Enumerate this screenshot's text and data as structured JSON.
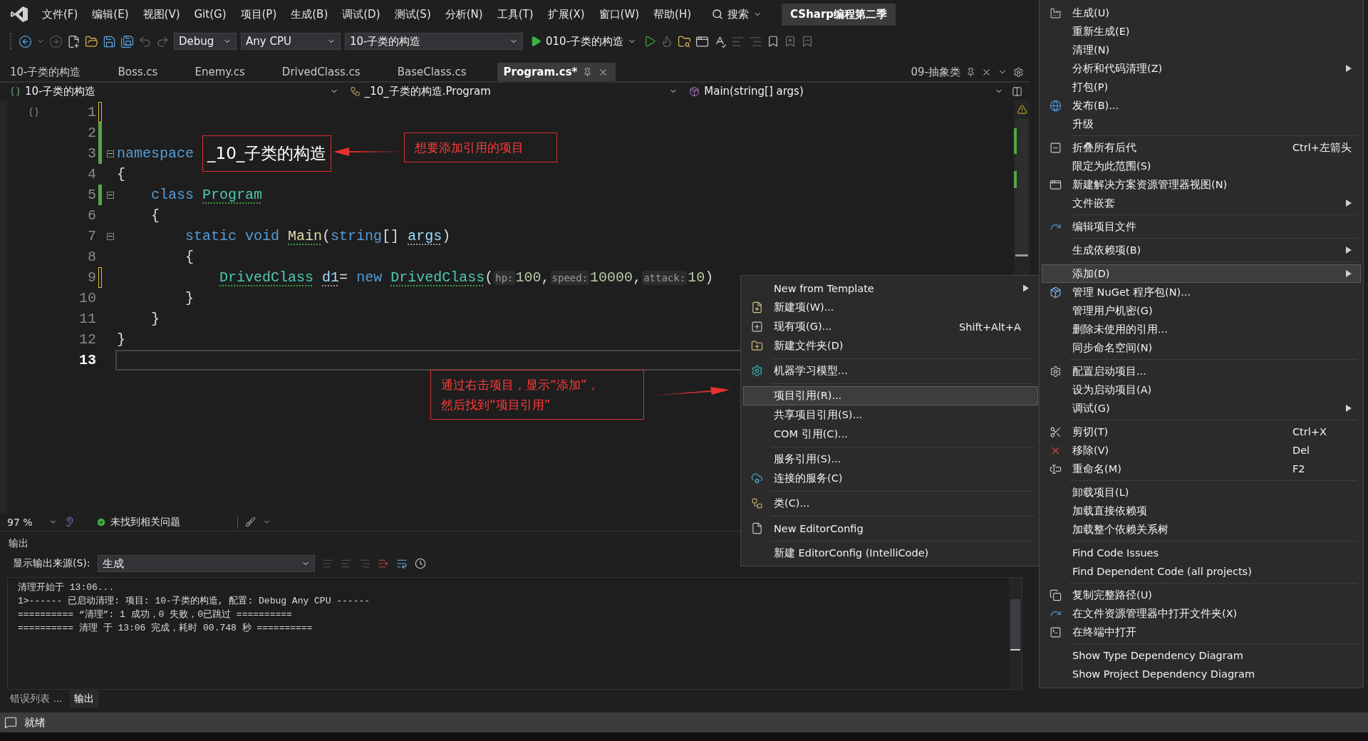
{
  "menu_bar": {
    "items": [
      "文件(F)",
      "编辑(E)",
      "视图(V)",
      "Git(G)",
      "项目(P)",
      "生成(B)",
      "调试(D)",
      "测试(S)",
      "分析(N)",
      "工具(T)",
      "扩展(X)",
      "窗口(W)",
      "帮助(H)"
    ],
    "search": "搜索",
    "solution_title": "CSharp编程第二季"
  },
  "toolbar": {
    "configuration": "Debug",
    "platform": "Any CPU",
    "startup_project": "10-子类的构造",
    "run_target": "010-子类的构造"
  },
  "tabs": [
    {
      "label": "10-子类的构造",
      "selected": false
    },
    {
      "label": "Boss.cs",
      "selected": false
    },
    {
      "label": "Enemy.cs",
      "selected": false
    },
    {
      "label": "DrivedClass.cs",
      "selected": false
    },
    {
      "label": "BaseClass.cs",
      "selected": false
    },
    {
      "label": "Program.cs*",
      "selected": true
    }
  ],
  "preview_tab": {
    "label": "09-抽象类"
  },
  "nav_bar": {
    "project": "10-子类的构造",
    "type": "_10_子类的构造.Program",
    "member": "Main(string[] args)"
  },
  "code": {
    "lines": [
      {
        "number": "1",
        "changed": true,
        "saved": false,
        "fold": false,
        "current": false
      },
      {
        "number": "2",
        "changed": true,
        "saved": true,
        "fold": false,
        "current": false
      },
      {
        "number": "3",
        "changed": true,
        "saved": true,
        "fold": true,
        "current": false,
        "tokens": [
          {
            "kind": "keyword",
            "text": "namespace "
          },
          {
            "kind": "boxed",
            "text": "_10_子类的构造"
          }
        ]
      },
      {
        "number": "4",
        "changed": false,
        "fold": false,
        "current": false,
        "tokens": [
          {
            "kind": "plain",
            "text": "{"
          }
        ]
      },
      {
        "number": "5",
        "changed": true,
        "saved": true,
        "fold": true,
        "current": false,
        "tokens": [
          {
            "kind": "keyword",
            "text": "    class "
          },
          {
            "kind": "type",
            "text": "Program",
            "dotted": true
          }
        ]
      },
      {
        "number": "6",
        "changed": false,
        "fold": false,
        "current": false,
        "tokens": [
          {
            "kind": "plain",
            "text": "    {"
          }
        ]
      },
      {
        "number": "7",
        "changed": false,
        "fold": true,
        "current": false,
        "tokens": [
          {
            "kind": "keyword",
            "text": "        static void "
          },
          {
            "kind": "method",
            "text": "Main",
            "dotted": true
          },
          {
            "kind": "plain",
            "text": "("
          },
          {
            "kind": "keyword",
            "text": "string"
          },
          {
            "kind": "plain",
            "text": "[] "
          },
          {
            "kind": "param",
            "text": "args",
            "dotted": true
          },
          {
            "kind": "plain",
            "text": ")"
          }
        ]
      },
      {
        "number": "8",
        "changed": false,
        "fold": false,
        "current": false,
        "tokens": [
          {
            "kind": "plain",
            "text": "        {"
          }
        ]
      },
      {
        "number": "9",
        "changed": true,
        "saved": false,
        "fold": false,
        "current": false,
        "tokens": [
          {
            "kind": "type",
            "text": "            DrivedClass",
            "dotted": true
          },
          {
            "kind": "param",
            "text": " d1",
            "dotted": true
          },
          {
            "kind": "plain",
            "text": "= "
          },
          {
            "kind": "keyword",
            "text": "new "
          },
          {
            "kind": "type",
            "text": "DrivedClass",
            "dotted": true
          },
          {
            "kind": "plain",
            "text": "("
          },
          {
            "kind": "hint",
            "text": "hp:"
          },
          {
            "kind": "number",
            "text": "100"
          },
          {
            "kind": "plain",
            "text": ","
          },
          {
            "kind": "hint",
            "text": "speed:"
          },
          {
            "kind": "number",
            "text": "10000"
          },
          {
            "kind": "plain",
            "text": ","
          },
          {
            "kind": "hint",
            "text": "attack:"
          },
          {
            "kind": "number",
            "text": "10"
          },
          {
            "kind": "plain",
            "text": ")"
          }
        ]
      },
      {
        "number": "10",
        "changed": false,
        "fold": false,
        "current": false,
        "tokens": [
          {
            "kind": "plain",
            "text": "        }"
          }
        ]
      },
      {
        "number": "11",
        "changed": false,
        "fold": false,
        "current": false,
        "tokens": [
          {
            "kind": "plain",
            "text": "    }"
          }
        ]
      },
      {
        "number": "12",
        "changed": false,
        "fold": false,
        "current": false,
        "tokens": [
          {
            "kind": "plain",
            "text": "}"
          }
        ]
      },
      {
        "number": "13",
        "changed": false,
        "fold": false,
        "current": true
      }
    ]
  },
  "editor_status": {
    "zoom": "97 %",
    "issues": "未找到相关问题"
  },
  "output": {
    "title": "输出",
    "source_label": "显示输出来源(S):",
    "source": "生成",
    "lines": [
      "清理开始于 13:06...",
      "1>------ 已启动清理: 项目: 10-子类的构造, 配置: Debug Any CPU ------",
      "========== “清理”: 1 成功，0 失败，0已跳过 ==========",
      "========== 清理 于 13:06 完成，耗时 00.748 秒 =========="
    ]
  },
  "bottom_tabs": [
    {
      "label": "错误列表 ...",
      "selected": false
    },
    {
      "label": "输出",
      "selected": true
    }
  ],
  "status_bar": {
    "text": "就绪"
  },
  "annotations": [
    {
      "lines": [
        "想要添加引用的项目"
      ]
    },
    {
      "lines": [
        "通过右击项目，显示“添加”，",
        "然后找到“项目引用”"
      ]
    }
  ],
  "add_submenu": {
    "items": [
      {
        "kind": "item",
        "label": "New from Template",
        "submenu": true,
        "selected": false
      },
      {
        "kind": "item",
        "label": "新建项(W)...",
        "submenu": false,
        "selected": false
      },
      {
        "kind": "item",
        "label": "现有项(G)...",
        "shortcut": "Shift+Alt+A",
        "submenu": false,
        "selected": false
      },
      {
        "kind": "item",
        "label": "新建文件夹(D)",
        "submenu": false,
        "selected": false
      },
      {
        "kind": "separator"
      },
      {
        "kind": "item",
        "label": "机器学习模型...",
        "submenu": false,
        "selected": false
      },
      {
        "kind": "separator"
      },
      {
        "kind": "item",
        "label": "项目引用(R)...",
        "submenu": false,
        "selected": true
      },
      {
        "kind": "item",
        "label": "共享项目引用(S)...",
        "submenu": false,
        "selected": false
      },
      {
        "kind": "item",
        "label": "COM 引用(C)...",
        "submenu": false,
        "selected": false
      },
      {
        "kind": "separator"
      },
      {
        "kind": "item",
        "label": "服务引用(S)...",
        "submenu": false,
        "selected": false
      },
      {
        "kind": "item",
        "label": "连接的服务(C)",
        "submenu": false,
        "selected": false
      },
      {
        "kind": "separator"
      },
      {
        "kind": "item",
        "label": "类(C)...",
        "submenu": false,
        "selected": false
      },
      {
        "kind": "separator"
      },
      {
        "kind": "item",
        "label": "New EditorConfig",
        "submenu": false,
        "selected": false
      },
      {
        "kind": "separator"
      },
      {
        "kind": "item",
        "label": "新建 EditorConfig (IntelliCode)",
        "submenu": false,
        "selected": false
      }
    ]
  },
  "project_menu": {
    "items": [
      {
        "kind": "item",
        "label": "生成(U)",
        "submenu": false,
        "selected": false
      },
      {
        "kind": "item",
        "label": "重新生成(E)",
        "submenu": false,
        "selected": false
      },
      {
        "kind": "item",
        "label": "清理(N)",
        "submenu": false,
        "selected": false
      },
      {
        "kind": "item",
        "label": "分析和代码清理(Z)",
        "submenu": true,
        "selected": false
      },
      {
        "kind": "item",
        "label": "打包(P)",
        "submenu": false,
        "selected": false
      },
      {
        "kind": "item",
        "label": "发布(B)...",
        "submenu": false,
        "selected": false
      },
      {
        "kind": "item",
        "label": "升级",
        "submenu": false,
        "selected": false
      },
      {
        "kind": "separator"
      },
      {
        "kind": "item",
        "label": "折叠所有后代",
        "shortcut": "Ctrl+左箭头",
        "submenu": false,
        "selected": false
      },
      {
        "kind": "item",
        "label": "限定为此范围(S)",
        "submenu": false,
        "selected": false
      },
      {
        "kind": "item",
        "label": "新建解决方案资源管理器视图(N)",
        "submenu": false,
        "selected": false
      },
      {
        "kind": "item",
        "label": "文件嵌套",
        "submenu": true,
        "selected": false
      },
      {
        "kind": "separator"
      },
      {
        "kind": "item",
        "label": "编辑项目文件",
        "submenu": false,
        "selected": false
      },
      {
        "kind": "separator"
      },
      {
        "kind": "item",
        "label": "生成依赖项(B)",
        "submenu": true,
        "selected": false
      },
      {
        "kind": "separator"
      },
      {
        "kind": "item",
        "label": "添加(D)",
        "submenu": true,
        "selected": true
      },
      {
        "kind": "item",
        "label": "管理 NuGet 程序包(N)...",
        "submenu": false,
        "selected": false
      },
      {
        "kind": "item",
        "label": "管理用户机密(G)",
        "submenu": false,
        "selected": false
      },
      {
        "kind": "item",
        "label": "删除未使用的引用...",
        "submenu": false,
        "selected": false
      },
      {
        "kind": "item",
        "label": "同步命名空间(N)",
        "submenu": false,
        "selected": false
      },
      {
        "kind": "separator"
      },
      {
        "kind": "item",
        "label": "配置启动项目...",
        "submenu": false,
        "selected": false
      },
      {
        "kind": "item",
        "label": "设为启动项目(A)",
        "submenu": false,
        "selected": false
      },
      {
        "kind": "item",
        "label": "调试(G)",
        "submenu": true,
        "selected": false
      },
      {
        "kind": "separator"
      },
      {
        "kind": "item",
        "label": "剪切(T)",
        "shortcut": "Ctrl+X",
        "submenu": false,
        "selected": false
      },
      {
        "kind": "item",
        "label": "移除(V)",
        "shortcut": "Del",
        "submenu": false,
        "selected": false
      },
      {
        "kind": "item",
        "label": "重命名(M)",
        "shortcut": "F2",
        "submenu": false,
        "selected": false
      },
      {
        "kind": "separator"
      },
      {
        "kind": "item",
        "label": "卸载项目(L)",
        "submenu": false,
        "selected": false
      },
      {
        "kind": "item",
        "label": "加载直接依赖项",
        "submenu": false,
        "selected": false
      },
      {
        "kind": "item",
        "label": "加载整个依赖关系树",
        "submenu": false,
        "selected": false
      },
      {
        "kind": "separator"
      },
      {
        "kind": "item",
        "label": "Find Code Issues",
        "submenu": false,
        "selected": false
      },
      {
        "kind": "item",
        "label": "Find Dependent Code (all projects)",
        "submenu": false,
        "selected": false
      },
      {
        "kind": "separator"
      },
      {
        "kind": "item",
        "label": "复制完整路径(U)",
        "submenu": false,
        "selected": false
      },
      {
        "kind": "item",
        "label": "在文件资源管理器中打开文件夹(X)",
        "submenu": false,
        "selected": false
      },
      {
        "kind": "item",
        "label": "在终端中打开",
        "submenu": false,
        "selected": false
      },
      {
        "kind": "separator"
      },
      {
        "kind": "item",
        "label": "Show Type Dependency Diagram",
        "submenu": false,
        "selected": false
      },
      {
        "kind": "item",
        "label": "Show Project Dependency Diagram",
        "submenu": false,
        "selected": false
      }
    ]
  }
}
